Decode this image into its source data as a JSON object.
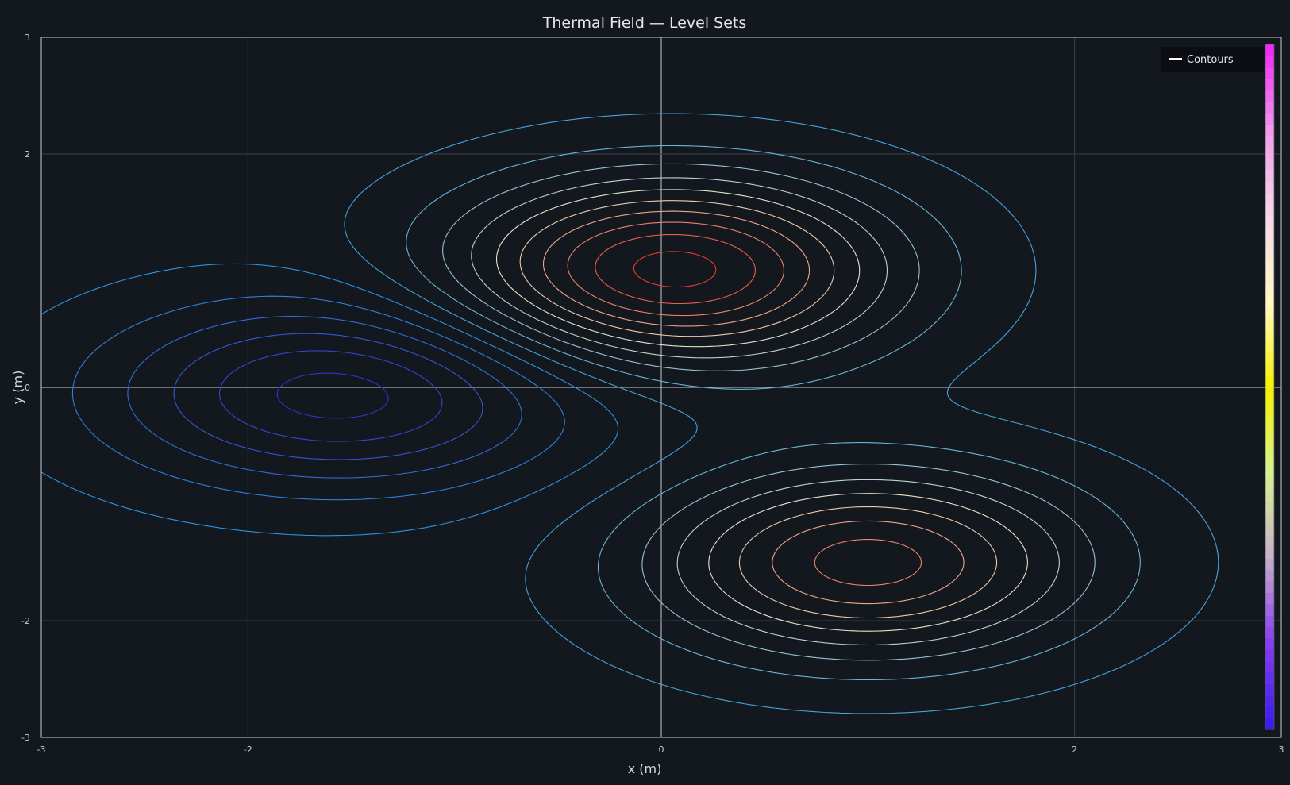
{
  "chart_data": {
    "type": "contour",
    "title": "Thermal Field — Level Sets",
    "xlabel": "x (m)",
    "ylabel": "y (m)",
    "xlim": [
      -3,
      3
    ],
    "ylim": [
      -3,
      3
    ],
    "x_ticks": [
      -3,
      -2,
      0,
      2,
      3
    ],
    "y_ticks": [
      3,
      2,
      0,
      -2,
      -3
    ],
    "grid": true,
    "legend": {
      "position": "top-right",
      "entries": [
        "Contours"
      ]
    },
    "colorbar": true,
    "peaks": [
      {
        "x": 0.05,
        "y": 1.0,
        "amplitude": 1.0,
        "sx": 0.72,
        "sy": 0.55
      },
      {
        "x": 1.0,
        "y": -1.5,
        "amplitude": 0.8,
        "sx": 0.72,
        "sy": 0.55
      },
      {
        "x": -1.55,
        "y": -0.05,
        "amplitude": -0.6,
        "sx": 0.78,
        "sy": 0.55
      }
    ],
    "levels": [
      -0.55,
      -0.45,
      -0.35,
      -0.25,
      -0.15,
      -0.05,
      0.05,
      0.15,
      0.25,
      0.35,
      0.45,
      0.55,
      0.65,
      0.75,
      0.85,
      0.95
    ],
    "colors": {
      "background": "#13171e",
      "axes": "#c9ccd3",
      "grid": "#3a3f4a",
      "zero_line": "#c9ccd3",
      "cold": "#3a2fd0",
      "cool": "#2b9be0",
      "warm": "#f0e7c8",
      "hot": "#ee3a2a",
      "legend_bg": "#0b0d12",
      "legend_line": "#ffffff"
    }
  }
}
